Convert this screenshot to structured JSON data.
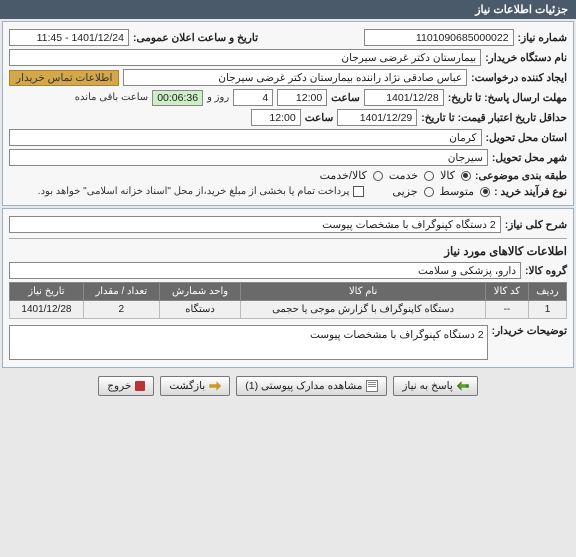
{
  "header": {
    "title": "جزئیات اطلاعات نیاز"
  },
  "fields": {
    "need_no_lbl": "شماره نیاز:",
    "need_no": "1101090685000022",
    "announce_lbl": "تاریخ و ساعت اعلان عمومی:",
    "announce": "1401/12/24 - 11:45",
    "buyer_lbl": "نام دستگاه خریدار:",
    "buyer": "بیمارستان دکتر غرضی سیرجان",
    "requester_lbl": "ایجاد کننده درخواست:",
    "requester": "عباس صادقی نژاد راننده بیمارستان دکتر غرضی سیرجان",
    "contact_link": "اطلاعات تماس خریدار",
    "deadline_lbl": "مهلت ارسال پاسخ: تا تاریخ:",
    "deadline_date": "1401/12/28",
    "time_lbl": "ساعت",
    "deadline_time": "12:00",
    "days_left": "4",
    "days_and": "روز و",
    "countdown": "00:06:36",
    "remain": "ساعت باقی مانده",
    "validity_lbl": "حداقل تاریخ اعتبار قیمت: تا تاریخ:",
    "validity_date": "1401/12/29",
    "validity_time": "12:00",
    "province_lbl": "استان محل تحویل:",
    "province": "کرمان",
    "city_lbl": "شهر محل تحویل:",
    "city": "سیرجان",
    "class_lbl": "طبقه بندی موضوعی:",
    "r_goods": "کالا",
    "r_service": "خدمت",
    "r_both": "کالا/خدمت",
    "process_lbl": "نوع فرآیند خرید :",
    "r_mid": "متوسط",
    "r_small": "جزیی",
    "pay_note": "پرداخت تمام یا بخشی از مبلغ خرید،از محل \"اسناد خزانه اسلامی\" خواهد بود."
  },
  "desc": {
    "lbl": "شرح کلی نیاز:",
    "val": "2 دستگاه کپنوگراف با مشخصات پیوست",
    "goods_title": "اطلاعات کالاهای مورد نیاز",
    "group_lbl": "گروه کالا:",
    "group": "دارو، پزشکی و سلامت"
  },
  "table": {
    "h_row": "ردیف",
    "h_code": "کد کالا",
    "h_name": "نام کالا",
    "h_unit": "واحد شمارش",
    "h_qty": "تعداد / مقدار",
    "h_date": "تاریخ نیاز",
    "r1": {
      "row": "1",
      "code": "--",
      "name": "دستگاه کاپنوگراف با گزارش موجی یا حجمی",
      "unit": "دستگاه",
      "qty": "2",
      "date": "1401/12/28"
    }
  },
  "buyer_note": {
    "lbl": "توضیحات خریدار:",
    "val": "2 دستگاه کپنوگراف با مشخصات پیوست"
  },
  "buttons": {
    "reply": "پاسخ به نیاز",
    "view": "مشاهده مدارک پیوستی (1)",
    "back": "بازگشت",
    "exit": "خروج"
  }
}
